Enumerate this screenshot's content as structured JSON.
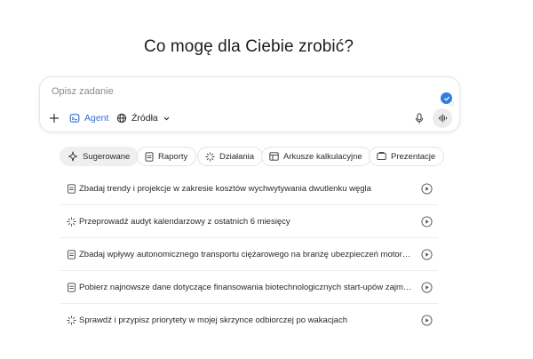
{
  "heading": "Co mogę dla Ciebie zrobić?",
  "composer": {
    "placeholder": "Opisz zadanie",
    "agent_label": "Agent",
    "sources_label": "Źródła"
  },
  "chips": [
    {
      "label": "Sugerowane",
      "icon": "sparkle-icon",
      "active": true
    },
    {
      "label": "Raporty",
      "icon": "document-icon",
      "active": false
    },
    {
      "label": "Działania",
      "icon": "spark-burst-icon",
      "active": false
    },
    {
      "label": "Arkusze kalkulacyjne",
      "icon": "table-icon",
      "active": false
    },
    {
      "label": "Prezentacje",
      "icon": "slides-icon",
      "active": false
    }
  ],
  "suggestions": [
    {
      "icon": "document-icon",
      "text": "Zbadaj trendy i projekcje w zakresie kosztów wychwytywania dwutlenku węgla"
    },
    {
      "icon": "spark-burst-icon",
      "text": "Przeprowadź audyt kalendarzowy z ostatnich 6 miesięcy"
    },
    {
      "icon": "document-icon",
      "text": "Zbadaj wpływy autonomicznego transportu ciężarowego na branżę ubezpieczeń motoryzacyjnych"
    },
    {
      "icon": "document-icon",
      "text": "Pobierz najnowsze dane dotyczące finansowania biotechnologicznych start-upów zajmujących się"
    },
    {
      "icon": "spark-burst-icon",
      "text": "Sprawdź i przypisz priorytety w mojej skrzynce odbiorczej po wakacjach"
    }
  ],
  "colors": {
    "accent": "#2f6fd1",
    "chip_active_bg": "#efefef"
  }
}
